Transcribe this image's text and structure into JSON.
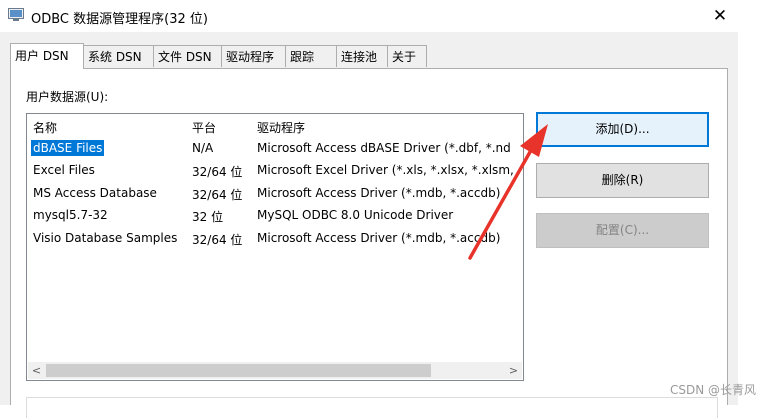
{
  "window": {
    "title": "ODBC 数据源管理程序(32 位)",
    "close_glyph": "✕"
  },
  "tabs": [
    {
      "label": "用户 DSN",
      "active": true
    },
    {
      "label": "系统 DSN"
    },
    {
      "label": "文件 DSN"
    },
    {
      "label": "驱动程序"
    },
    {
      "label": "跟踪"
    },
    {
      "label": "连接池"
    },
    {
      "label": "关于"
    }
  ],
  "list": {
    "label": "用户数据源(U):",
    "headers": {
      "name": "名称",
      "platform": "平台",
      "driver": "驱动程序"
    },
    "rows": [
      {
        "name": "dBASE Files",
        "platform": "N/A",
        "driver": "Microsoft Access dBASE Driver (*.dbf, *.nd",
        "selected": true
      },
      {
        "name": "Excel Files",
        "platform": "32/64 位",
        "driver": "Microsoft Excel Driver (*.xls, *.xlsx, *.xlsm,"
      },
      {
        "name": "MS Access Database",
        "platform": "32/64 位",
        "driver": "Microsoft Access Driver (*.mdb, *.accdb)"
      },
      {
        "name": "mysql5.7-32",
        "platform": "32 位",
        "driver": "MySQL ODBC 8.0 Unicode Driver"
      },
      {
        "name": "Visio Database Samples",
        "platform": "32/64 位",
        "driver": "Microsoft Access Driver (*.mdb, *.accdb)"
      }
    ],
    "scroll_left": "<",
    "scroll_right": ">"
  },
  "buttons": {
    "add": "添加(D)...",
    "remove": "删除(R)",
    "configure": "配置(C)..."
  },
  "colors": {
    "selection": "#0078d7",
    "arrow": "#e8332a"
  },
  "watermark": "CSDN @长青风"
}
